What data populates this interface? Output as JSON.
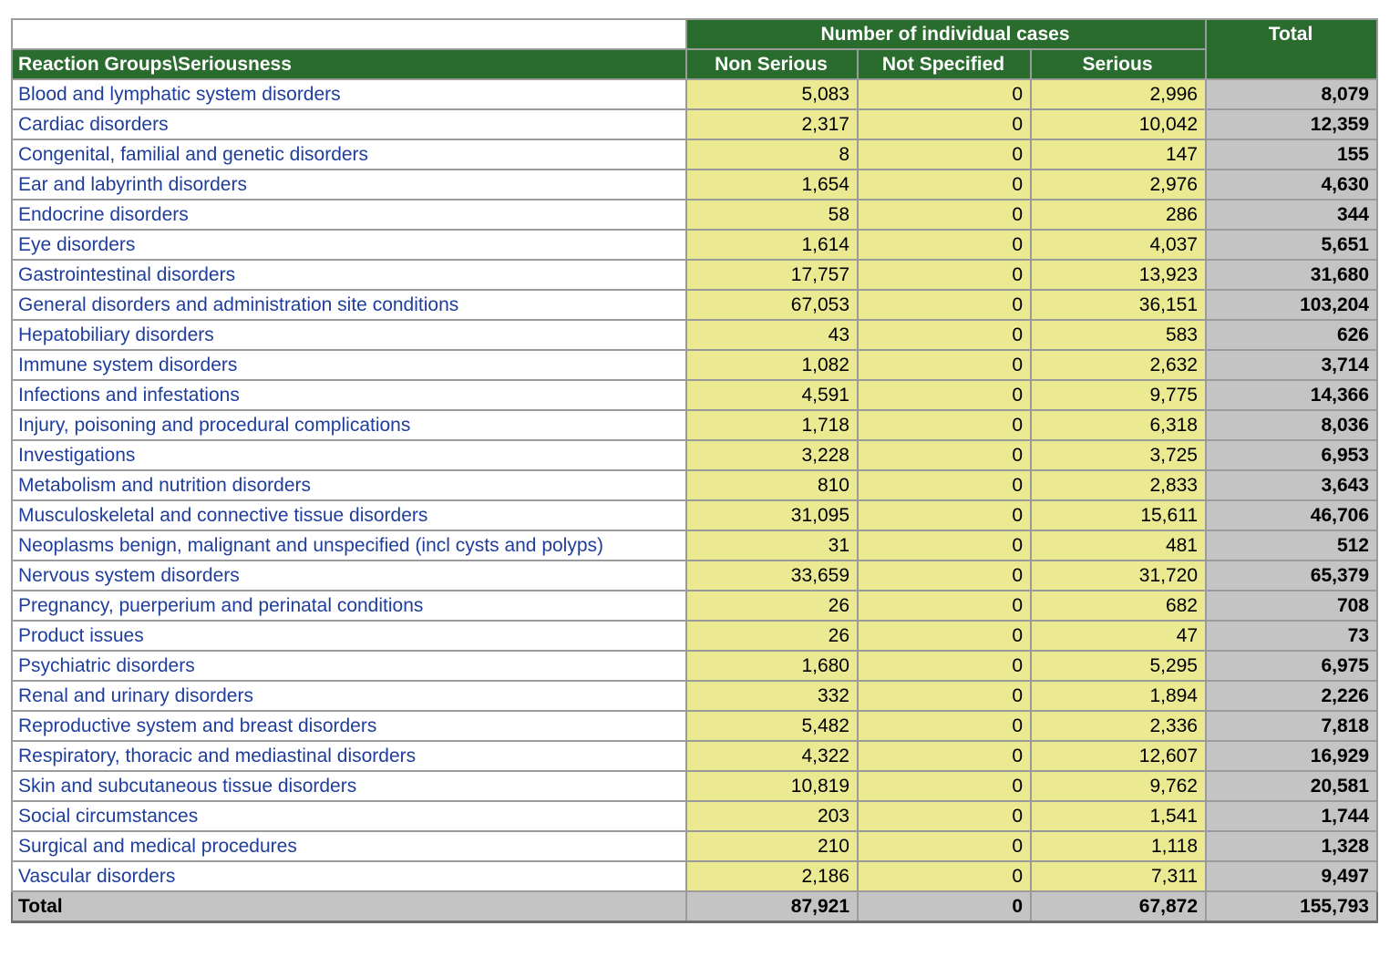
{
  "table": {
    "corner_header": "Reaction Groups\\Seriousness",
    "group_header": "Number of individual cases",
    "column_headers": [
      "Non Serious",
      "Not Specified",
      "Serious"
    ],
    "total_header": "Total",
    "rows": [
      {
        "label": "Blood and lymphatic system disorders",
        "non_serious": "5,083",
        "not_specified": "0",
        "serious": "2,996",
        "total": "8,079"
      },
      {
        "label": "Cardiac disorders",
        "non_serious": "2,317",
        "not_specified": "0",
        "serious": "10,042",
        "total": "12,359"
      },
      {
        "label": "Congenital, familial and genetic disorders",
        "non_serious": "8",
        "not_specified": "0",
        "serious": "147",
        "total": "155"
      },
      {
        "label": "Ear and labyrinth disorders",
        "non_serious": "1,654",
        "not_specified": "0",
        "serious": "2,976",
        "total": "4,630"
      },
      {
        "label": "Endocrine disorders",
        "non_serious": "58",
        "not_specified": "0",
        "serious": "286",
        "total": "344"
      },
      {
        "label": "Eye disorders",
        "non_serious": "1,614",
        "not_specified": "0",
        "serious": "4,037",
        "total": "5,651"
      },
      {
        "label": "Gastrointestinal disorders",
        "non_serious": "17,757",
        "not_specified": "0",
        "serious": "13,923",
        "total": "31,680"
      },
      {
        "label": "General disorders and administration site conditions",
        "non_serious": "67,053",
        "not_specified": "0",
        "serious": "36,151",
        "total": "103,204"
      },
      {
        "label": "Hepatobiliary disorders",
        "non_serious": "43",
        "not_specified": "0",
        "serious": "583",
        "total": "626"
      },
      {
        "label": "Immune system disorders",
        "non_serious": "1,082",
        "not_specified": "0",
        "serious": "2,632",
        "total": "3,714"
      },
      {
        "label": "Infections and infestations",
        "non_serious": "4,591",
        "not_specified": "0",
        "serious": "9,775",
        "total": "14,366"
      },
      {
        "label": "Injury, poisoning and procedural complications",
        "non_serious": "1,718",
        "not_specified": "0",
        "serious": "6,318",
        "total": "8,036"
      },
      {
        "label": "Investigations",
        "non_serious": "3,228",
        "not_specified": "0",
        "serious": "3,725",
        "total": "6,953"
      },
      {
        "label": "Metabolism and nutrition disorders",
        "non_serious": "810",
        "not_specified": "0",
        "serious": "2,833",
        "total": "3,643"
      },
      {
        "label": "Musculoskeletal and connective tissue disorders",
        "non_serious": "31,095",
        "not_specified": "0",
        "serious": "15,611",
        "total": "46,706"
      },
      {
        "label": "Neoplasms benign, malignant and unspecified (incl cysts and polyps)",
        "non_serious": "31",
        "not_specified": "0",
        "serious": "481",
        "total": "512"
      },
      {
        "label": "Nervous system disorders",
        "non_serious": "33,659",
        "not_specified": "0",
        "serious": "31,720",
        "total": "65,379"
      },
      {
        "label": "Pregnancy, puerperium and perinatal conditions",
        "non_serious": "26",
        "not_specified": "0",
        "serious": "682",
        "total": "708"
      },
      {
        "label": "Product issues",
        "non_serious": "26",
        "not_specified": "0",
        "serious": "47",
        "total": "73"
      },
      {
        "label": "Psychiatric disorders",
        "non_serious": "1,680",
        "not_specified": "0",
        "serious": "5,295",
        "total": "6,975"
      },
      {
        "label": "Renal and urinary disorders",
        "non_serious": "332",
        "not_specified": "0",
        "serious": "1,894",
        "total": "2,226"
      },
      {
        "label": "Reproductive system and breast disorders",
        "non_serious": "5,482",
        "not_specified": "0",
        "serious": "2,336",
        "total": "7,818"
      },
      {
        "label": "Respiratory, thoracic and mediastinal disorders",
        "non_serious": "4,322",
        "not_specified": "0",
        "serious": "12,607",
        "total": "16,929"
      },
      {
        "label": "Skin and subcutaneous tissue disorders",
        "non_serious": "10,819",
        "not_specified": "0",
        "serious": "9,762",
        "total": "20,581"
      },
      {
        "label": "Social circumstances",
        "non_serious": "203",
        "not_specified": "0",
        "serious": "1,541",
        "total": "1,744"
      },
      {
        "label": "Surgical and medical procedures",
        "non_serious": "210",
        "not_specified": "0",
        "serious": "1,118",
        "total": "1,328"
      },
      {
        "label": "Vascular disorders",
        "non_serious": "2,186",
        "not_specified": "0",
        "serious": "7,311",
        "total": "9,497"
      }
    ],
    "total_row": {
      "label": "Total",
      "non_serious": "87,921",
      "not_specified": "0",
      "serious": "67,872",
      "total": "155,793"
    }
  },
  "colors": {
    "header_green": "#2A6B2E",
    "header_text": "#ffffff",
    "cell_yellow": "#EBEA93",
    "total_gray": "#C4C4C4",
    "label_blue": "#1F3E9B",
    "grid_line": "#9b9b9b",
    "outer_edge": "#6f6f6f"
  },
  "chart_data": {
    "type": "table",
    "title": "Number of individual cases",
    "columns": [
      "Reaction Groups\\Seriousness",
      "Non Serious",
      "Not Specified",
      "Serious",
      "Total"
    ],
    "rows": [
      [
        "Blood and lymphatic system disorders",
        5083,
        0,
        2996,
        8079
      ],
      [
        "Cardiac disorders",
        2317,
        0,
        10042,
        12359
      ],
      [
        "Congenital, familial and genetic disorders",
        8,
        0,
        147,
        155
      ],
      [
        "Ear and labyrinth disorders",
        1654,
        0,
        2976,
        4630
      ],
      [
        "Endocrine disorders",
        58,
        0,
        286,
        344
      ],
      [
        "Eye disorders",
        1614,
        0,
        4037,
        5651
      ],
      [
        "Gastrointestinal disorders",
        17757,
        0,
        13923,
        31680
      ],
      [
        "General disorders and administration site conditions",
        67053,
        0,
        36151,
        103204
      ],
      [
        "Hepatobiliary disorders",
        43,
        0,
        583,
        626
      ],
      [
        "Immune system disorders",
        1082,
        0,
        2632,
        3714
      ],
      [
        "Infections and infestations",
        4591,
        0,
        9775,
        14366
      ],
      [
        "Injury, poisoning and procedural complications",
        1718,
        0,
        6318,
        8036
      ],
      [
        "Investigations",
        3228,
        0,
        3725,
        6953
      ],
      [
        "Metabolism and nutrition disorders",
        810,
        0,
        2833,
        3643
      ],
      [
        "Musculoskeletal and connective tissue disorders",
        31095,
        0,
        15611,
        46706
      ],
      [
        "Neoplasms benign, malignant and unspecified (incl cysts and polyps)",
        31,
        0,
        481,
        512
      ],
      [
        "Nervous system disorders",
        33659,
        0,
        31720,
        65379
      ],
      [
        "Pregnancy, puerperium and perinatal conditions",
        26,
        0,
        682,
        708
      ],
      [
        "Product issues",
        26,
        0,
        47,
        73
      ],
      [
        "Psychiatric disorders",
        1680,
        0,
        5295,
        6975
      ],
      [
        "Renal and urinary disorders",
        332,
        0,
        1894,
        2226
      ],
      [
        "Reproductive system and breast disorders",
        5482,
        0,
        2336,
        7818
      ],
      [
        "Respiratory, thoracic and mediastinal disorders",
        4322,
        0,
        12607,
        16929
      ],
      [
        "Skin and subcutaneous tissue disorders",
        10819,
        0,
        9762,
        20581
      ],
      [
        "Social circumstances",
        203,
        0,
        1541,
        1744
      ],
      [
        "Surgical and medical procedures",
        210,
        0,
        1118,
        1328
      ],
      [
        "Vascular disorders",
        2186,
        0,
        7311,
        9497
      ]
    ],
    "total_row": [
      "Total",
      87921,
      0,
      67872,
      155793
    ]
  }
}
